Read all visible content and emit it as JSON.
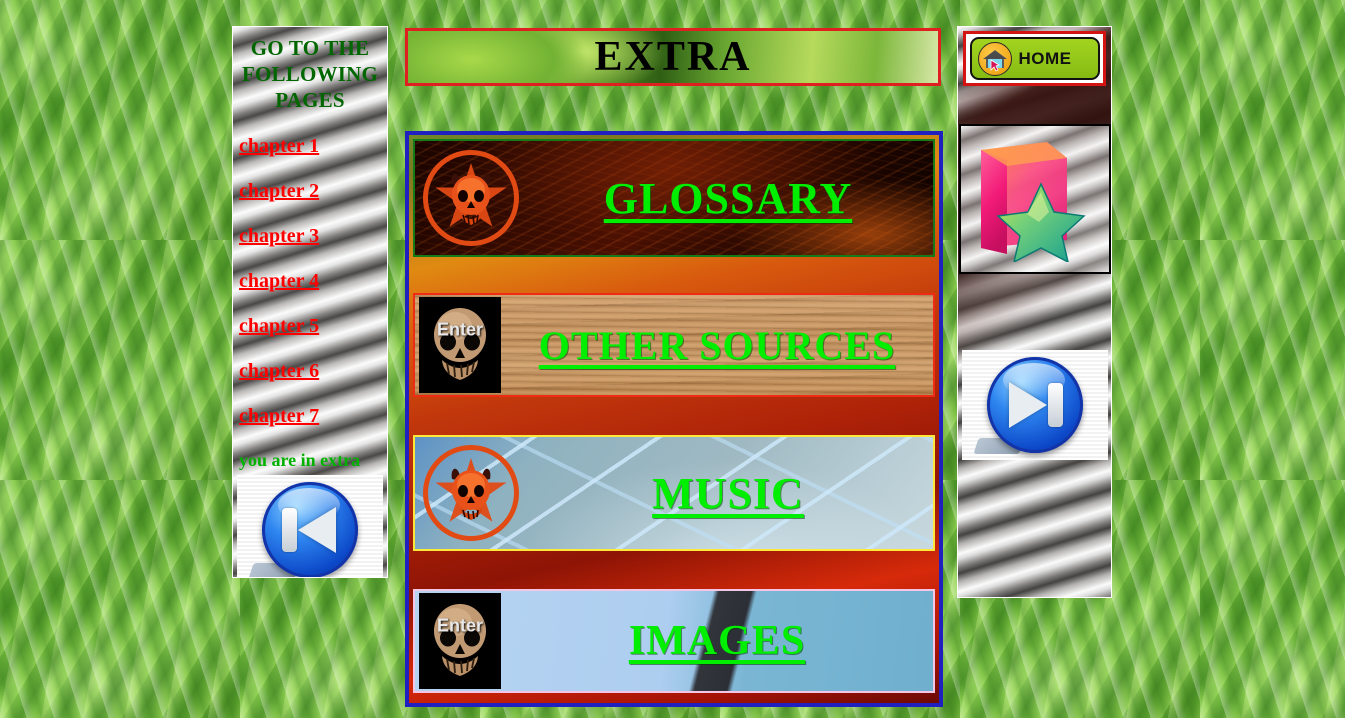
{
  "header": {
    "title": "EXTRA",
    "banner_border_color": "#e02020"
  },
  "left_sidebar": {
    "title": "GO TO THE FOLLOWING PAGES",
    "chapters": [
      {
        "label": "chapter 1"
      },
      {
        "label": "chapter 2"
      },
      {
        "label": "chapter 3"
      },
      {
        "label": "chapter 4"
      },
      {
        "label": "chapter 5"
      },
      {
        "label": "chapter 6"
      },
      {
        "label": "chapter 7"
      }
    ],
    "status": "you are in extra",
    "link_color": "#ff0000",
    "title_color": "#006600",
    "status_color": "#00b200",
    "prev_button": {
      "name": "previous-page-button",
      "icon": "skip-previous-icon"
    }
  },
  "main": {
    "panels": [
      {
        "id": "glossary",
        "title": "GLOSSARY",
        "thumb_icon": "demon-skull-pentagram-icon",
        "thumb_label": "",
        "border_color": "#157b18",
        "title_color": "#00ee00"
      },
      {
        "id": "other-sources",
        "title": "OTHER SOURCES",
        "thumb_icon": "skull-enter-icon",
        "thumb_label": "Enter",
        "border_color": "#ef2b14",
        "title_color": "#00ee00"
      },
      {
        "id": "music",
        "title": "MUSIC",
        "thumb_icon": "demon-skull-pentagram-icon",
        "thumb_label": "",
        "border_color": "#ffe83a",
        "title_color": "#00ee00"
      },
      {
        "id": "images",
        "title": "IMAGES",
        "thumb_icon": "skull-enter-icon",
        "thumb_label": "Enter",
        "border_color": "#f3c6e6",
        "title_color": "#00ee00"
      }
    ],
    "container_border_color": "#2020c0"
  },
  "right_sidebar": {
    "home_button": {
      "label": "HOME",
      "icon": "house-cursor-icon",
      "border_color": "#d41313"
    },
    "folder_thumb": {
      "name": "folder-star-image",
      "icon": "folder-star-icon"
    },
    "next_button": {
      "name": "next-page-button",
      "icon": "skip-next-icon"
    }
  }
}
